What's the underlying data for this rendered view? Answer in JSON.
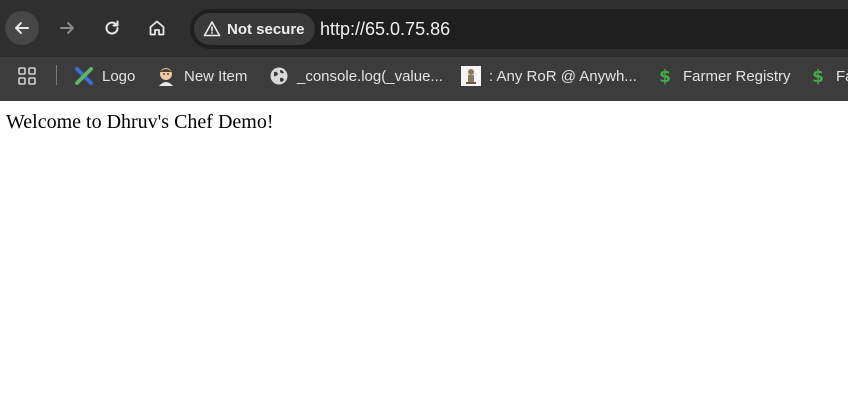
{
  "browser": {
    "security_label": "Not secure",
    "url": "http://65.0.75.86",
    "nav": {
      "back_icon": "arrow-left",
      "forward_icon": "arrow-right",
      "reload_icon": "reload",
      "home_icon": "home"
    },
    "bookmarks": [
      {
        "label": "Logo",
        "icon": "logo-favicon"
      },
      {
        "label": "New Item",
        "icon": "avatar-favicon"
      },
      {
        "label": "_console.log(_value...",
        "icon": "globe-favicon"
      },
      {
        "label": ": Any RoR @ Anywh...",
        "icon": "emblem-favicon"
      },
      {
        "label": "Farmer Registry",
        "icon": "dollar-favicon"
      },
      {
        "label": "Fa",
        "icon": "dollar-favicon"
      }
    ]
  },
  "page": {
    "welcome": "Welcome to Dhruv's Chef Demo!"
  },
  "colors": {
    "toolbar_bg": "#2f2f2f",
    "bookmarks_bg": "#3c3c3c",
    "omnibox_bg": "#1f1f1f",
    "page_bg": "#ffffff",
    "dollar_green": "#3fae49"
  }
}
